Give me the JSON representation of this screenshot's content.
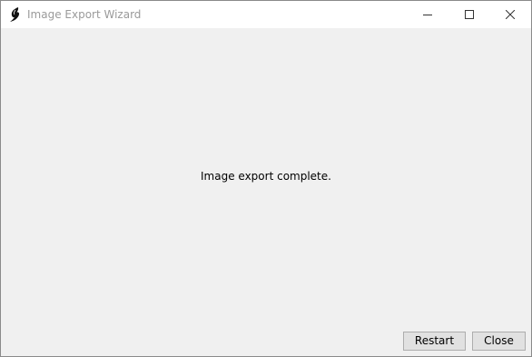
{
  "window": {
    "title": "Image Export Wizard",
    "app_icon": "app-logo-icon",
    "controls": {
      "minimize_icon": "minimize-icon",
      "maximize_icon": "maximize-icon",
      "close_icon": "close-icon"
    }
  },
  "main": {
    "message": "Image export complete."
  },
  "footer": {
    "restart_label": "Restart",
    "close_label": "Close"
  },
  "colors": {
    "titlebar_bg": "#ffffff",
    "window_bg": "#f0f0f0",
    "title_text": "#9a9a9a",
    "button_bg": "#e1e1e1",
    "button_border": "#adadad"
  }
}
